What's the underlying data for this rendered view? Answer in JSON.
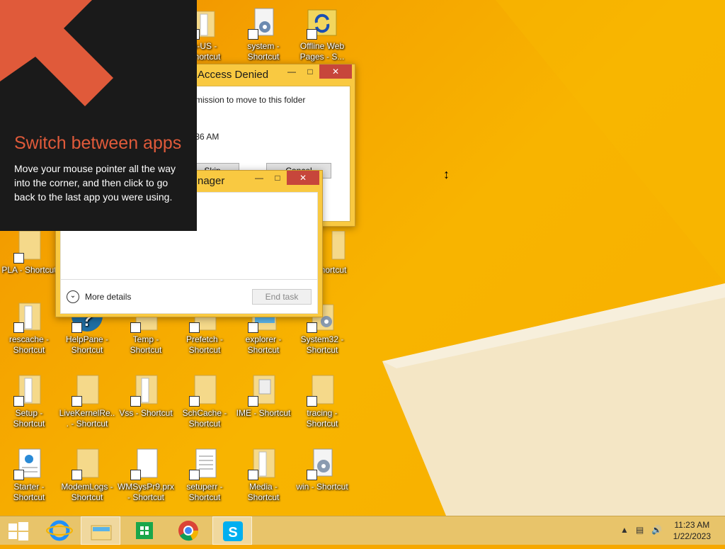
{
  "desktop_icons": [
    {
      "id": "enus",
      "label": "n-US - Shortcut",
      "kind": "folder"
    },
    {
      "id": "system",
      "label": "system - Shortcut",
      "kind": "gear"
    },
    {
      "id": "offline",
      "label": "Offline Web Pages - S...",
      "kind": "sync-folder"
    },
    {
      "id": "pla",
      "label": "PLA - Shortcut",
      "kind": "folder"
    },
    {
      "id": "hortcut",
      "label": "hortcut",
      "kind": "folder"
    },
    {
      "id": "rescache",
      "label": "rescache - Shortcut",
      "kind": "folder"
    },
    {
      "id": "helppane",
      "label": "HelpPane - Shortcut",
      "kind": "help"
    },
    {
      "id": "temp",
      "label": "Temp - Shortcut",
      "kind": "folder"
    },
    {
      "id": "prefetch",
      "label": "Prefetch - Shortcut",
      "kind": "folder"
    },
    {
      "id": "explorer",
      "label": "explorer - Shortcut",
      "kind": "explorer"
    },
    {
      "id": "system32",
      "label": "System32 - Shortcut",
      "kind": "gear-folder"
    },
    {
      "id": "setup",
      "label": "Setup - Shortcut",
      "kind": "folder"
    },
    {
      "id": "livekernel",
      "label": "LiveKernelRe... - Shortcut",
      "kind": "folder"
    },
    {
      "id": "vss",
      "label": "Vss - Shortcut",
      "kind": "folder"
    },
    {
      "id": "schcache",
      "label": "SchCache - Shortcut",
      "kind": "folder"
    },
    {
      "id": "ime",
      "label": "IME - Shortcut",
      "kind": "folder"
    },
    {
      "id": "tracing",
      "label": "tracing - Shortcut",
      "kind": "folder"
    },
    {
      "id": "starter",
      "label": "Starter - Shortcut",
      "kind": "xml"
    },
    {
      "id": "modemlogs",
      "label": "ModemLogs - Shortcut",
      "kind": "folder"
    },
    {
      "id": "wmsys",
      "label": "WMSysPr9.prx - Shortcut",
      "kind": "file"
    },
    {
      "id": "setuperr",
      "label": "setuperr - Shortcut",
      "kind": "text"
    },
    {
      "id": "media",
      "label": "Media - Shortcut",
      "kind": "folder"
    },
    {
      "id": "win",
      "label": "win - Shortcut",
      "kind": "gear"
    }
  ],
  "access_denied": {
    "title": "Access Denied",
    "message": "rmission to move to this folder",
    "time": ":36 AM",
    "skip_label": "Skip",
    "cancel_label": "Cancel"
  },
  "task_manager": {
    "title": "nager",
    "more_details": "More details",
    "end_task": "End task"
  },
  "tip": {
    "title": "Switch between apps",
    "body": "Move your mouse pointer all the way into the corner, and then click to go back to the last app you were using."
  },
  "taskbar": {
    "time": "11:23 AM",
    "date": "1/22/2023",
    "items": [
      {
        "name": "start",
        "icon": "windows-logo"
      },
      {
        "name": "ie",
        "icon": "internet-explorer"
      },
      {
        "name": "file-explorer",
        "icon": "folder"
      },
      {
        "name": "store",
        "icon": "store"
      },
      {
        "name": "chrome",
        "icon": "chrome"
      },
      {
        "name": "skype",
        "icon": "skype"
      }
    ]
  },
  "colors": {
    "accent": "#f4a200",
    "tip_title": "#e05a3a",
    "close_button": "#c7463b"
  }
}
